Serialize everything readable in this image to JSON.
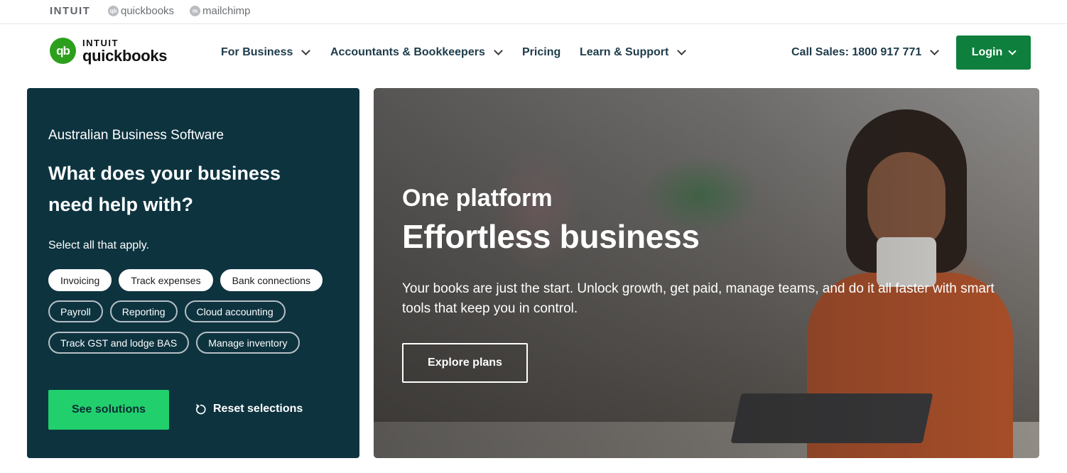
{
  "brandbar": {
    "brands": [
      "INTUIT",
      "quickbooks",
      "mailchimp"
    ],
    "qb_mini_icon": "qb-logo-icon",
    "mc_mini_icon": "mailchimp-logo-icon"
  },
  "nav": {
    "logo_intuit": "INTUIT",
    "logo_qb": "quickbooks",
    "logo_mark": "qb",
    "items": [
      {
        "label": "For Business",
        "dropdown": true
      },
      {
        "label": "Accountants & Bookkeepers",
        "dropdown": true
      },
      {
        "label": "Pricing",
        "dropdown": false
      },
      {
        "label": "Learn & Support",
        "dropdown": true
      }
    ],
    "call_sales": "Call Sales: 1800 917 771",
    "login_label": "Login"
  },
  "panel": {
    "kicker": "Australian Business Software",
    "title": "What does your business need help with?",
    "subtitle": "Select all that apply.",
    "chip_rows": [
      [
        {
          "label": "Invoicing",
          "selected": true
        },
        {
          "label": "Track expenses",
          "selected": true
        },
        {
          "label": "Bank connections",
          "selected": true
        }
      ],
      [
        {
          "label": "Payroll",
          "selected": false
        },
        {
          "label": "Reporting",
          "selected": false
        },
        {
          "label": "Cloud accounting",
          "selected": false
        }
      ],
      [
        {
          "label": "Track GST and lodge BAS",
          "selected": false
        },
        {
          "label": "Manage inventory",
          "selected": false
        }
      ]
    ],
    "see_solutions": "See solutions",
    "reset_label": "Reset selections"
  },
  "hero": {
    "kicker": "One platform",
    "title": "Effortless business",
    "body": "Your books are just the start. Unlock growth, get paid, manage teams, and do it all faster with smart tools that keep you in control.",
    "cta": "Explore plans"
  },
  "colors": {
    "panel_bg": "#0d333f",
    "login_bg": "#0e7f3c",
    "see_solutions_bg": "#21d06d",
    "logo_green": "#2ca01c"
  }
}
